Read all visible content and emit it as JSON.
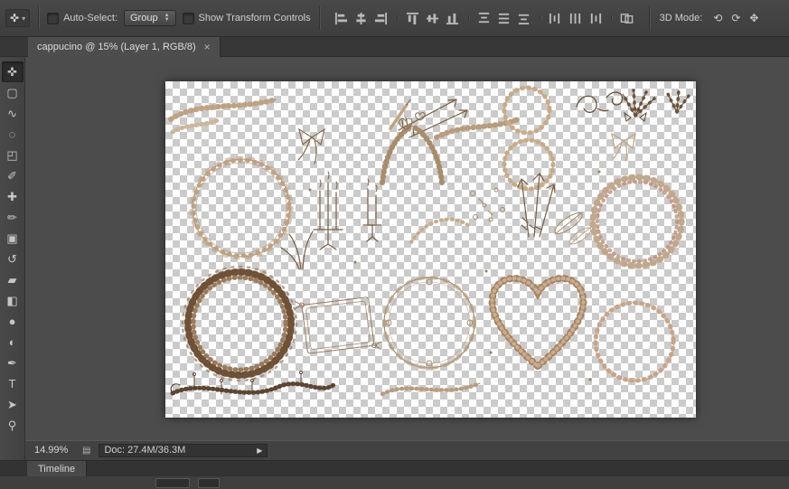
{
  "options_bar": {
    "caret_glyph": "▾",
    "auto_select_label": "Auto-Select:",
    "group_value": "Group",
    "show_transform_label": "Show Transform Controls",
    "mode_label": "3D Mode:",
    "align_groups": [
      [
        "align-left-edges",
        "align-horizontal-centers",
        "align-right-edges"
      ],
      [
        "align-top-edges",
        "align-vertical-centers",
        "align-bottom-edges"
      ],
      [
        "distribute-top-edges",
        "distribute-vertical-centers",
        "distribute-bottom-edges"
      ],
      [
        "distribute-left-edges",
        "distribute-horizontal-centers",
        "distribute-right-edges"
      ],
      [
        "auto-align-layers"
      ]
    ],
    "mode_icons": [
      {
        "name": "3d-orbit-icon",
        "glyph": "⟲"
      },
      {
        "name": "3d-roll-icon",
        "glyph": "⟳"
      },
      {
        "name": "3d-drag-icon",
        "glyph": "✥"
      }
    ]
  },
  "tab": {
    "title": "cappucino @ 15% (Layer 1, RGB/8)",
    "close_glyph": "×"
  },
  "tools": [
    {
      "name": "move-tool",
      "glyph": "✜"
    },
    {
      "name": "rectangular-marquee-tool",
      "glyph": "▢"
    },
    {
      "name": "lasso-tool",
      "glyph": "∿"
    },
    {
      "name": "quick-selection-tool",
      "glyph": "◌"
    },
    {
      "name": "crop-tool",
      "glyph": "◰"
    },
    {
      "name": "eyedropper-tool",
      "glyph": "✐"
    },
    {
      "name": "healing-brush-tool",
      "glyph": "✚"
    },
    {
      "name": "brush-tool",
      "glyph": "✏"
    },
    {
      "name": "clone-stamp-tool",
      "glyph": "▣"
    },
    {
      "name": "history-brush-tool",
      "glyph": "↺"
    },
    {
      "name": "eraser-tool",
      "glyph": "▰"
    },
    {
      "name": "gradient-tool",
      "glyph": "◧"
    },
    {
      "name": "blur-tool",
      "glyph": "●"
    },
    {
      "name": "dodge-tool",
      "glyph": "◐"
    },
    {
      "name": "pen-tool",
      "glyph": "✒"
    },
    {
      "name": "type-tool",
      "glyph": "T"
    },
    {
      "name": "path-selection-tool",
      "glyph": "➤"
    },
    {
      "name": "zoom-tool",
      "glyph": "⚲"
    }
  ],
  "status_bar": {
    "zoom": "14.99%",
    "preview_icon_glyph": "▤",
    "doc_info": "Doc: 27.4M/36.3M",
    "menu_arrow": "▶"
  },
  "timeline": {
    "label": "Timeline"
  },
  "canvas": {
    "artwork_palette": [
      "#6f5136",
      "#8a6b4e",
      "#9a7b5c",
      "#b99c7c",
      "#c2a88b",
      "#bd8f7a"
    ],
    "checker_colors": [
      "#ffffff",
      "#cbcbcb"
    ]
  }
}
